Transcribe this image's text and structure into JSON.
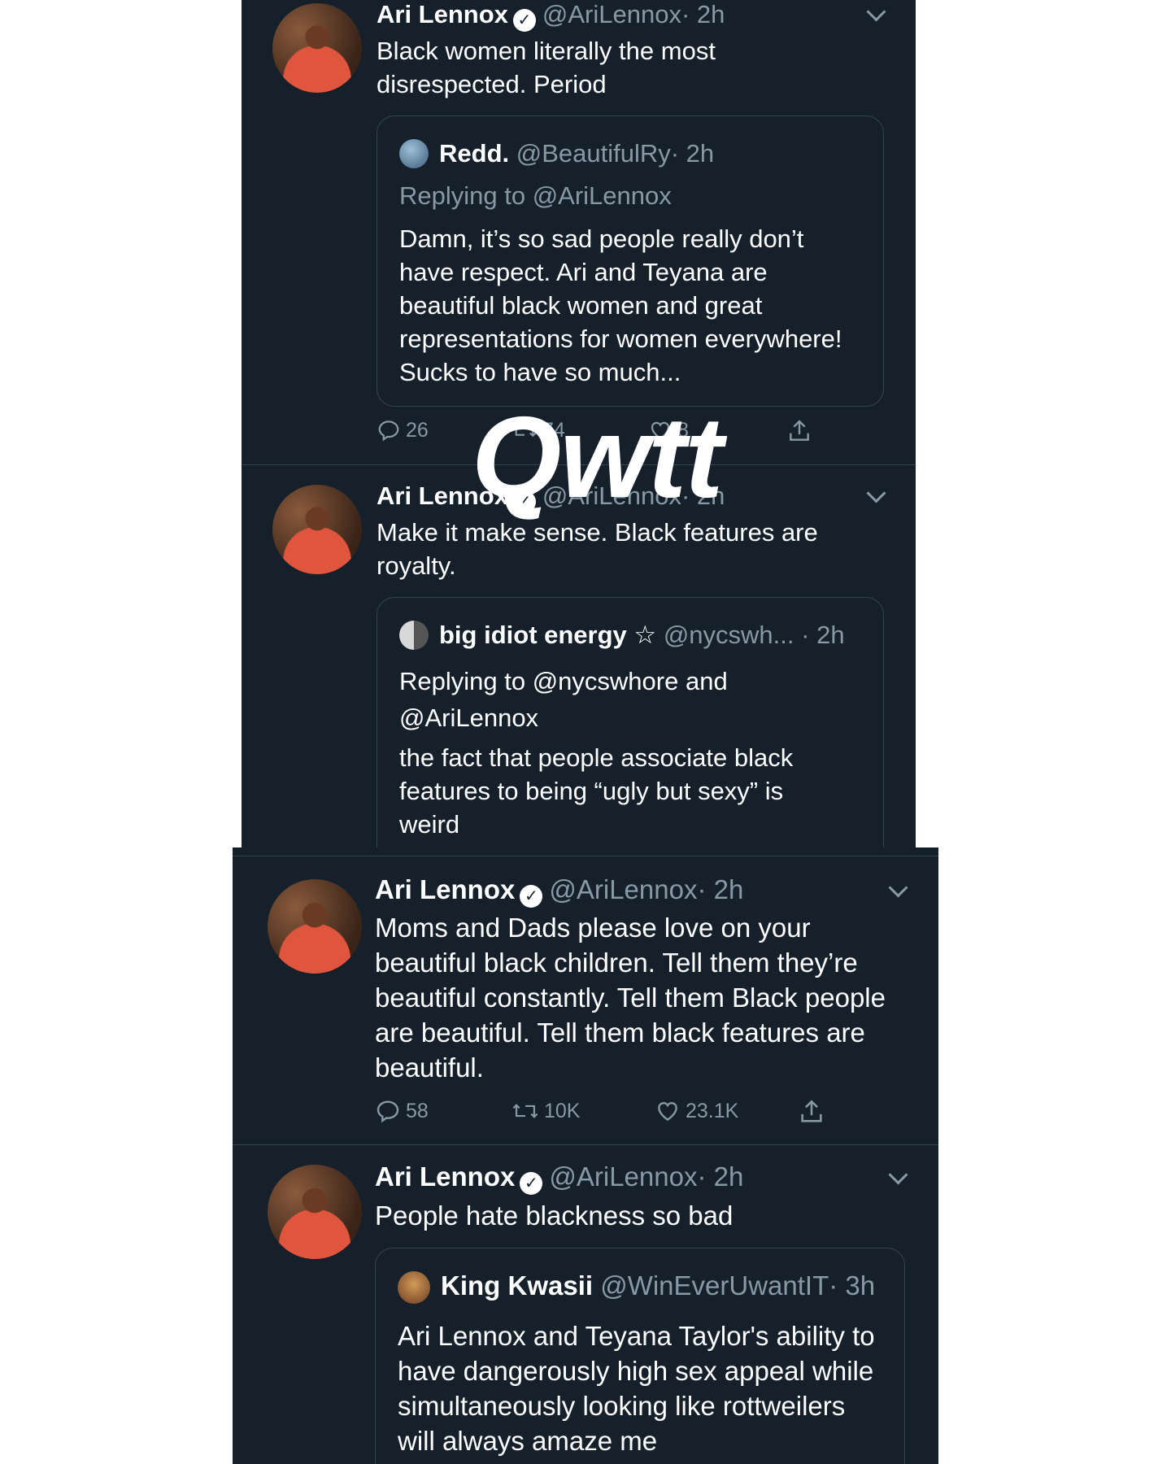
{
  "colors": {
    "background": "#15202b",
    "text": "#ffffff",
    "secondary_text": "#8899a6",
    "divider": "#38444d"
  },
  "watermark": "Qwtt",
  "tweets": [
    {
      "name": "Ari Lennox",
      "verified": true,
      "handle": "@AriLennox",
      "time": "· 2h",
      "text": "Black women literally the most disrespected. Period",
      "quote": {
        "name": "Redd.",
        "handle": "@BeautifulRy",
        "time": "· 2h",
        "replying_to": "Replying to @AriLennox",
        "text": "Damn, it’s so sad people really don’t have respect. Ari and Teyana are beautiful black women and great representations for women everywhere! Sucks to have so much..."
      },
      "stats": {
        "replies": "26",
        "retweets": "74",
        "likes": "8"
      }
    },
    {
      "name": "Ari Lennox",
      "verified": true,
      "handle": "@AriLennox",
      "time": "· 2h",
      "text": "Make it make sense. Black features are royalty.",
      "quote": {
        "name": "big idiot energy ☆",
        "handle": "@nycswh...",
        "time": "· 2h",
        "replying_to": "Replying to @nycswhore and @AriLennox",
        "text": "the fact that people associate black features to being “ugly but sexy” is weird"
      }
    },
    {
      "name": "Ari Lennox",
      "verified": true,
      "handle": "@AriLennox",
      "time": "· 2h",
      "text": "Moms and Dads please love on your beautiful black children. Tell them they’re beautiful constantly. Tell them Black people are beautiful. Tell them black features are beautiful.",
      "stats": {
        "replies": "58",
        "retweets": "10K",
        "likes": "23.1K"
      }
    },
    {
      "name": "Ari Lennox",
      "verified": true,
      "handle": "@AriLennox",
      "time": "· 2h",
      "text": "People hate blackness so bad",
      "quote": {
        "name": "King Kwasii",
        "handle": "@WinEverUwantIT",
        "time": "· 3h",
        "text": "Ari Lennox and Teyana Taylor's ability to have dangerously high sex appeal while simultaneously looking like rottweilers will always amaze me"
      }
    }
  ]
}
